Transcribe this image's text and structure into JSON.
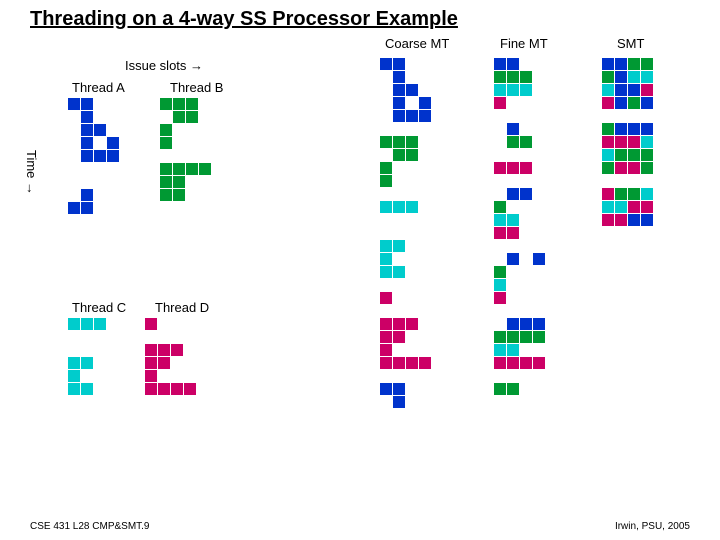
{
  "title": "Threading on a 4-way SS Processor Example",
  "issue_slots_label": "Issue slots →",
  "time_label": "Time →",
  "footer_left": "CSE 431 L28 CMP&SMT.9",
  "footer_right": "Irwin, PSU, 2005",
  "columns": {
    "coarse": "Coarse MT",
    "fine": "Fine MT",
    "smt": "SMT"
  },
  "thread_labels": {
    "A": "Thread A",
    "B": "Thread B",
    "C": "Thread C",
    "D": "Thread D"
  },
  "chart_data": {
    "type": "table",
    "legend": {
      "A": "Thread A (blue)",
      "B": "Thread B (green)",
      "C": "Thread C (cyan)",
      "D": "Thread D (magenta)",
      "E": "empty"
    },
    "threadA": [
      [
        "A",
        "A",
        "E",
        "E"
      ],
      [
        "E",
        "A",
        "E",
        "E"
      ],
      [
        "E",
        "A",
        "A",
        "E"
      ],
      [
        "E",
        "A",
        "E",
        "A"
      ],
      [
        "E",
        "A",
        "A",
        "A"
      ],
      [
        "E",
        "E",
        "E",
        "E"
      ],
      [
        "E",
        "E",
        "E",
        "E"
      ],
      [
        "E",
        "A",
        "E",
        "E"
      ],
      [
        "A",
        "A",
        "E",
        "E"
      ]
    ],
    "threadB": [
      [
        "B",
        "B",
        "B",
        "E"
      ],
      [
        "E",
        "B",
        "B",
        "E"
      ],
      [
        "B",
        "E",
        "E",
        "E"
      ],
      [
        "B",
        "E",
        "E",
        "E"
      ],
      [
        "E",
        "E",
        "E",
        "E"
      ],
      [
        "B",
        "B",
        "B",
        "B"
      ],
      [
        "B",
        "B",
        "E",
        "E"
      ],
      [
        "B",
        "B",
        "E",
        "E"
      ],
      [
        "E",
        "E",
        "E",
        "E"
      ]
    ],
    "threadC": [
      [
        "C",
        "C",
        "C",
        "E"
      ],
      [
        "E",
        "E",
        "E",
        "E"
      ],
      [
        "E",
        "E",
        "E",
        "E"
      ],
      [
        "C",
        "C",
        "E",
        "E"
      ],
      [
        "C",
        "E",
        "E",
        "E"
      ],
      [
        "C",
        "C",
        "E",
        "E"
      ]
    ],
    "threadD": [
      [
        "D",
        "E",
        "E",
        "E"
      ],
      [
        "E",
        "E",
        "E",
        "E"
      ],
      [
        "D",
        "D",
        "D",
        "E"
      ],
      [
        "D",
        "D",
        "E",
        "E"
      ],
      [
        "D",
        "E",
        "E",
        "E"
      ],
      [
        "D",
        "D",
        "D",
        "D"
      ]
    ],
    "coarseMT": [
      [
        "A",
        "A",
        "E",
        "E"
      ],
      [
        "E",
        "A",
        "E",
        "E"
      ],
      [
        "E",
        "A",
        "A",
        "E"
      ],
      [
        "E",
        "A",
        "E",
        "A"
      ],
      [
        "E",
        "A",
        "A",
        "A"
      ],
      [
        "E",
        "E",
        "E",
        "E"
      ],
      [
        "B",
        "B",
        "B",
        "E"
      ],
      [
        "E",
        "B",
        "B",
        "E"
      ],
      [
        "B",
        "E",
        "E",
        "E"
      ],
      [
        "B",
        "E",
        "E",
        "E"
      ],
      [
        "E",
        "E",
        "E",
        "E"
      ],
      [
        "C",
        "C",
        "C",
        "E"
      ],
      [
        "E",
        "E",
        "E",
        "E"
      ],
      [
        "E",
        "E",
        "E",
        "E"
      ],
      [
        "C",
        "C",
        "E",
        "E"
      ],
      [
        "C",
        "E",
        "E",
        "E"
      ],
      [
        "C",
        "C",
        "E",
        "E"
      ],
      [
        "E",
        "E",
        "E",
        "E"
      ],
      [
        "D",
        "E",
        "E",
        "E"
      ],
      [
        "E",
        "E",
        "E",
        "E"
      ],
      [
        "D",
        "D",
        "D",
        "E"
      ],
      [
        "D",
        "D",
        "E",
        "E"
      ],
      [
        "D",
        "E",
        "E",
        "E"
      ],
      [
        "D",
        "D",
        "D",
        "D"
      ],
      [
        "E",
        "E",
        "E",
        "E"
      ],
      [
        "A",
        "A",
        "E",
        "E"
      ],
      [
        "E",
        "A",
        "E",
        "E"
      ]
    ],
    "fineMT": [
      [
        "A",
        "A",
        "E",
        "E"
      ],
      [
        "B",
        "B",
        "B",
        "E"
      ],
      [
        "C",
        "C",
        "C",
        "E"
      ],
      [
        "D",
        "E",
        "E",
        "E"
      ],
      [
        "E",
        "E",
        "E",
        "E"
      ],
      [
        "E",
        "A",
        "E",
        "E"
      ],
      [
        "E",
        "B",
        "B",
        "E"
      ],
      [
        "E",
        "E",
        "E",
        "E"
      ],
      [
        "D",
        "D",
        "D",
        "E"
      ],
      [
        "E",
        "E",
        "E",
        "E"
      ],
      [
        "E",
        "A",
        "A",
        "E"
      ],
      [
        "B",
        "E",
        "E",
        "E"
      ],
      [
        "C",
        "C",
        "E",
        "E"
      ],
      [
        "D",
        "D",
        "E",
        "E"
      ],
      [
        "E",
        "E",
        "E",
        "E"
      ],
      [
        "E",
        "A",
        "E",
        "A"
      ],
      [
        "B",
        "E",
        "E",
        "E"
      ],
      [
        "C",
        "E",
        "E",
        "E"
      ],
      [
        "D",
        "E",
        "E",
        "E"
      ],
      [
        "E",
        "E",
        "E",
        "E"
      ],
      [
        "E",
        "A",
        "A",
        "A"
      ],
      [
        "B",
        "B",
        "B",
        "B"
      ],
      [
        "C",
        "C",
        "E",
        "E"
      ],
      [
        "D",
        "D",
        "D",
        "D"
      ],
      [
        "E",
        "E",
        "E",
        "E"
      ],
      [
        "B",
        "B",
        "E",
        "E"
      ],
      [
        "E",
        "E",
        "E",
        "E"
      ]
    ],
    "smt": [
      [
        "A",
        "A",
        "B",
        "B"
      ],
      [
        "B",
        "A",
        "C",
        "C"
      ],
      [
        "C",
        "A",
        "A",
        "D"
      ],
      [
        "D",
        "A",
        "B",
        "A"
      ],
      [
        "E",
        "E",
        "E",
        "E"
      ],
      [
        "B",
        "A",
        "A",
        "A"
      ],
      [
        "D",
        "D",
        "D",
        "C"
      ],
      [
        "C",
        "B",
        "B",
        "B"
      ],
      [
        "B",
        "D",
        "D",
        "B"
      ],
      [
        "E",
        "E",
        "E",
        "E"
      ],
      [
        "D",
        "B",
        "B",
        "C"
      ],
      [
        "C",
        "C",
        "D",
        "D"
      ],
      [
        "D",
        "D",
        "A",
        "A"
      ],
      [
        "E",
        "E",
        "E",
        "E"
      ],
      [
        "E",
        "E",
        "E",
        "E"
      ],
      [
        "E",
        "E",
        "E",
        "E"
      ],
      [
        "E",
        "E",
        "E",
        "E"
      ],
      [
        "E",
        "E",
        "E",
        "E"
      ],
      [
        "E",
        "E",
        "E",
        "E"
      ],
      [
        "E",
        "E",
        "E",
        "E"
      ],
      [
        "E",
        "E",
        "E",
        "E"
      ],
      [
        "E",
        "E",
        "E",
        "E"
      ],
      [
        "E",
        "E",
        "E",
        "E"
      ],
      [
        "E",
        "E",
        "E",
        "E"
      ],
      [
        "E",
        "E",
        "E",
        "E"
      ],
      [
        "E",
        "E",
        "E",
        "E"
      ],
      [
        "E",
        "E",
        "E",
        "E"
      ]
    ]
  }
}
